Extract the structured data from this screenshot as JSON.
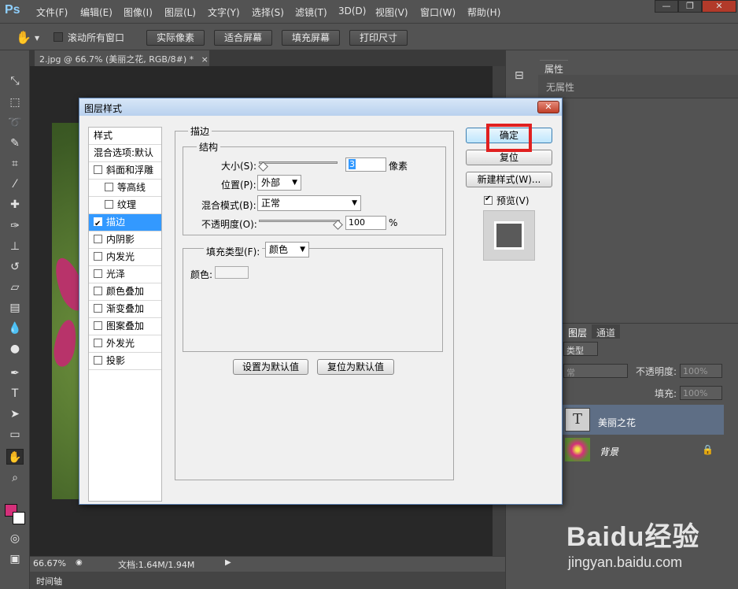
{
  "app": {
    "logo": "Ps"
  },
  "menu": [
    "文件(F)",
    "编辑(E)",
    "图像(I)",
    "图层(L)",
    "文字(Y)",
    "选择(S)",
    "滤镜(T)",
    "3D(D)",
    "视图(V)",
    "窗口(W)",
    "帮助(H)"
  ],
  "window_controls": {
    "minimize": "—",
    "restore": "❐",
    "close": "✕"
  },
  "options": {
    "scroll_all_label": "滚动所有窗口",
    "actual_pixels": "实际像素",
    "fit_screen": "适合屏幕",
    "fill_screen": "填充屏幕",
    "print_size": "打印尺寸"
  },
  "document": {
    "tab_title": "2.jpg @ 66.7% (美丽之花, RGB/8#) *",
    "tab_close": "×"
  },
  "status": {
    "zoom": "66.67%",
    "doc_info": "文档:1.64M/1.94M"
  },
  "timeline": {
    "label": "时间轴"
  },
  "properties": {
    "tab": "属性",
    "empty": "无属性"
  },
  "layers": {
    "tabs": [
      "图层",
      "通道"
    ],
    "kind_label": "类型",
    "blend": "常",
    "opacity_label": "不透明度:",
    "opacity_value": "100%",
    "fill_label": "填充:",
    "fill_value": "100%",
    "items": [
      {
        "name": "美丽之花",
        "thumb": "T"
      },
      {
        "name": "背景"
      }
    ]
  },
  "dialog": {
    "title": "图层样式",
    "close": "✕",
    "styles_header": "样式",
    "blend_options": "混合选项:默认",
    "style_items": [
      {
        "label": "斜面和浮雕",
        "checked": false,
        "indent": false
      },
      {
        "label": "等高线",
        "checked": false,
        "indent": true
      },
      {
        "label": "纹理",
        "checked": false,
        "indent": true
      },
      {
        "label": "描边",
        "checked": true,
        "indent": false,
        "selected": true
      },
      {
        "label": "内阴影",
        "checked": false,
        "indent": false
      },
      {
        "label": "内发光",
        "checked": false,
        "indent": false
      },
      {
        "label": "光泽",
        "checked": false,
        "indent": false
      },
      {
        "label": "颜色叠加",
        "checked": false,
        "indent": false
      },
      {
        "label": "渐变叠加",
        "checked": false,
        "indent": false
      },
      {
        "label": "图案叠加",
        "checked": false,
        "indent": false
      },
      {
        "label": "外发光",
        "checked": false,
        "indent": false
      },
      {
        "label": "投影",
        "checked": false,
        "indent": false
      }
    ],
    "stroke": {
      "group_title": "描边",
      "structure_title": "结构",
      "size_label": "大小(S):",
      "size_value": "3",
      "size_unit": "像素",
      "position_label": "位置(P):",
      "position_value": "外部",
      "blend_label": "混合模式(B):",
      "blend_value": "正常",
      "opacity_label": "不透明度(O):",
      "opacity_value": "100",
      "opacity_unit": "%",
      "fill_type_label": "填充类型(F):",
      "fill_type_value": "颜色",
      "color_label": "颜色:"
    },
    "buttons": {
      "ok": "确定",
      "reset": "复位",
      "new_style": "新建样式(W)...",
      "preview": "预览(V)",
      "set_default": "设置为默认值",
      "reset_default": "复位为默认值"
    }
  },
  "watermark": {
    "brand": "Baidu经验",
    "url": "jingyan.baidu.com"
  },
  "colors": {
    "accent_select": "#3399ff",
    "highlight": "#e02020",
    "foreground": "#d4307a",
    "background": "#ffffff"
  }
}
